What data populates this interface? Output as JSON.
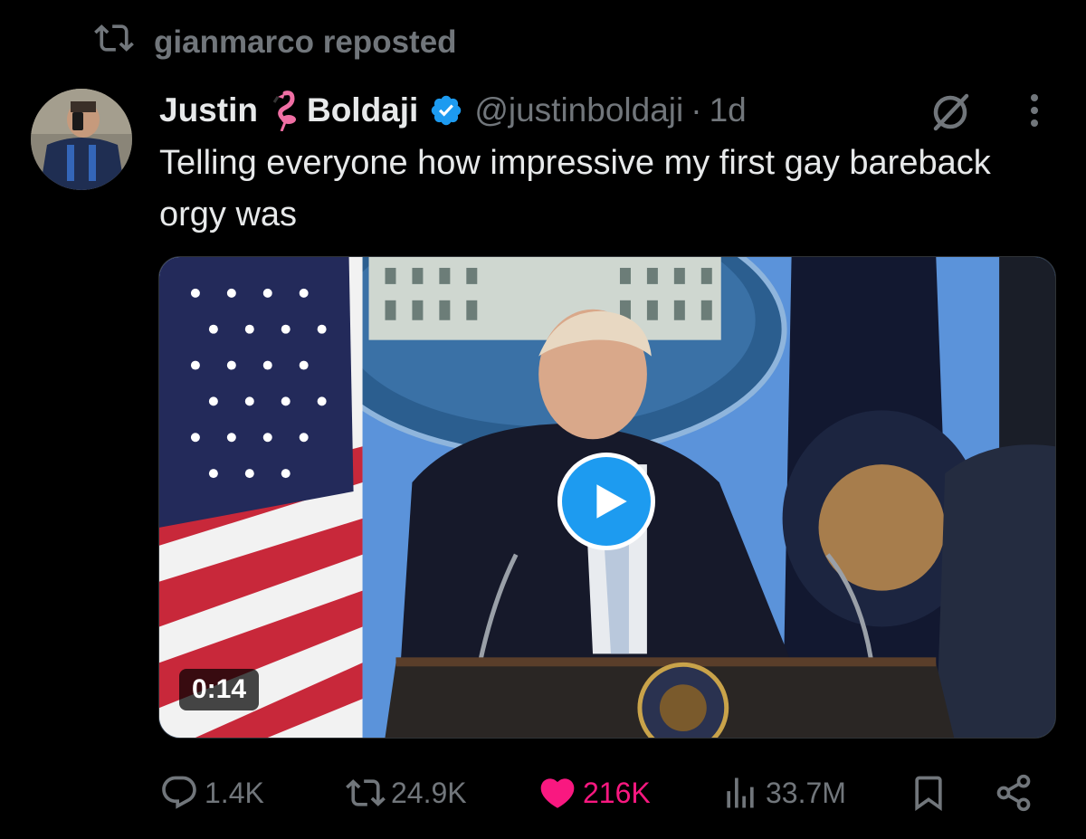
{
  "repost": {
    "text": "gianmarco reposted",
    "icon": "repost-icon"
  },
  "tweet": {
    "display_name_first": "Justin",
    "display_name_emoji": "flamingo-emoji",
    "display_name_last": "Boldaji",
    "verified": true,
    "verified_color": "#1d9bf0",
    "handle": "@justinboldaji",
    "separator": "·",
    "time": "1d",
    "text": "Telling everyone how impressive my first gay bareback orgy was",
    "grok_icon": "grok-icon",
    "more_icon": "more-icon"
  },
  "media": {
    "type": "video",
    "duration": "0:14",
    "play_icon": "play-icon",
    "play_color": "#1d9bf0"
  },
  "actions": {
    "reply": {
      "icon": "reply-icon",
      "count": "1.4K"
    },
    "repost": {
      "icon": "repost-icon",
      "count": "24.9K"
    },
    "like": {
      "icon": "heart-icon",
      "count": "216K",
      "active": true,
      "color": "#f91880"
    },
    "views": {
      "icon": "views-icon",
      "count": "33.7M"
    },
    "bookmark": {
      "icon": "bookmark-icon"
    },
    "share": {
      "icon": "share-icon"
    }
  }
}
